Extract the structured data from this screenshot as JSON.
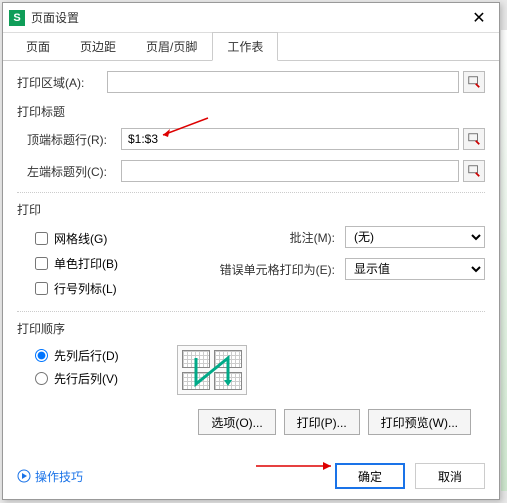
{
  "titlebar": {
    "title": "页面设置"
  },
  "tabs": [
    "页面",
    "页边距",
    "页眉/页脚",
    "工作表"
  ],
  "active_tab": 3,
  "print_area": {
    "label": "打印区域(A):",
    "value": ""
  },
  "titles": {
    "section": "打印标题",
    "top_row": {
      "label": "顶端标题行(R):",
      "value": "$1:$3"
    },
    "left_col": {
      "label": "左端标题列(C):",
      "value": ""
    }
  },
  "print": {
    "section": "打印",
    "gridlines": "网格线(G)",
    "monochrome": "单色打印(B)",
    "headings": "行号列标(L)",
    "comments_label": "批注(M):",
    "comments_value": "(无)",
    "errors_label": "错误单元格打印为(E):",
    "errors_value": "显示值"
  },
  "order": {
    "section": "打印顺序",
    "down_over": "先列后行(D)",
    "over_down": "先行后列(V)"
  },
  "buttons": {
    "options": "选项(O)...",
    "print": "打印(P)...",
    "preview": "打印预览(W)..."
  },
  "footer": {
    "tips": "操作技巧",
    "ok": "确定",
    "cancel": "取消"
  }
}
